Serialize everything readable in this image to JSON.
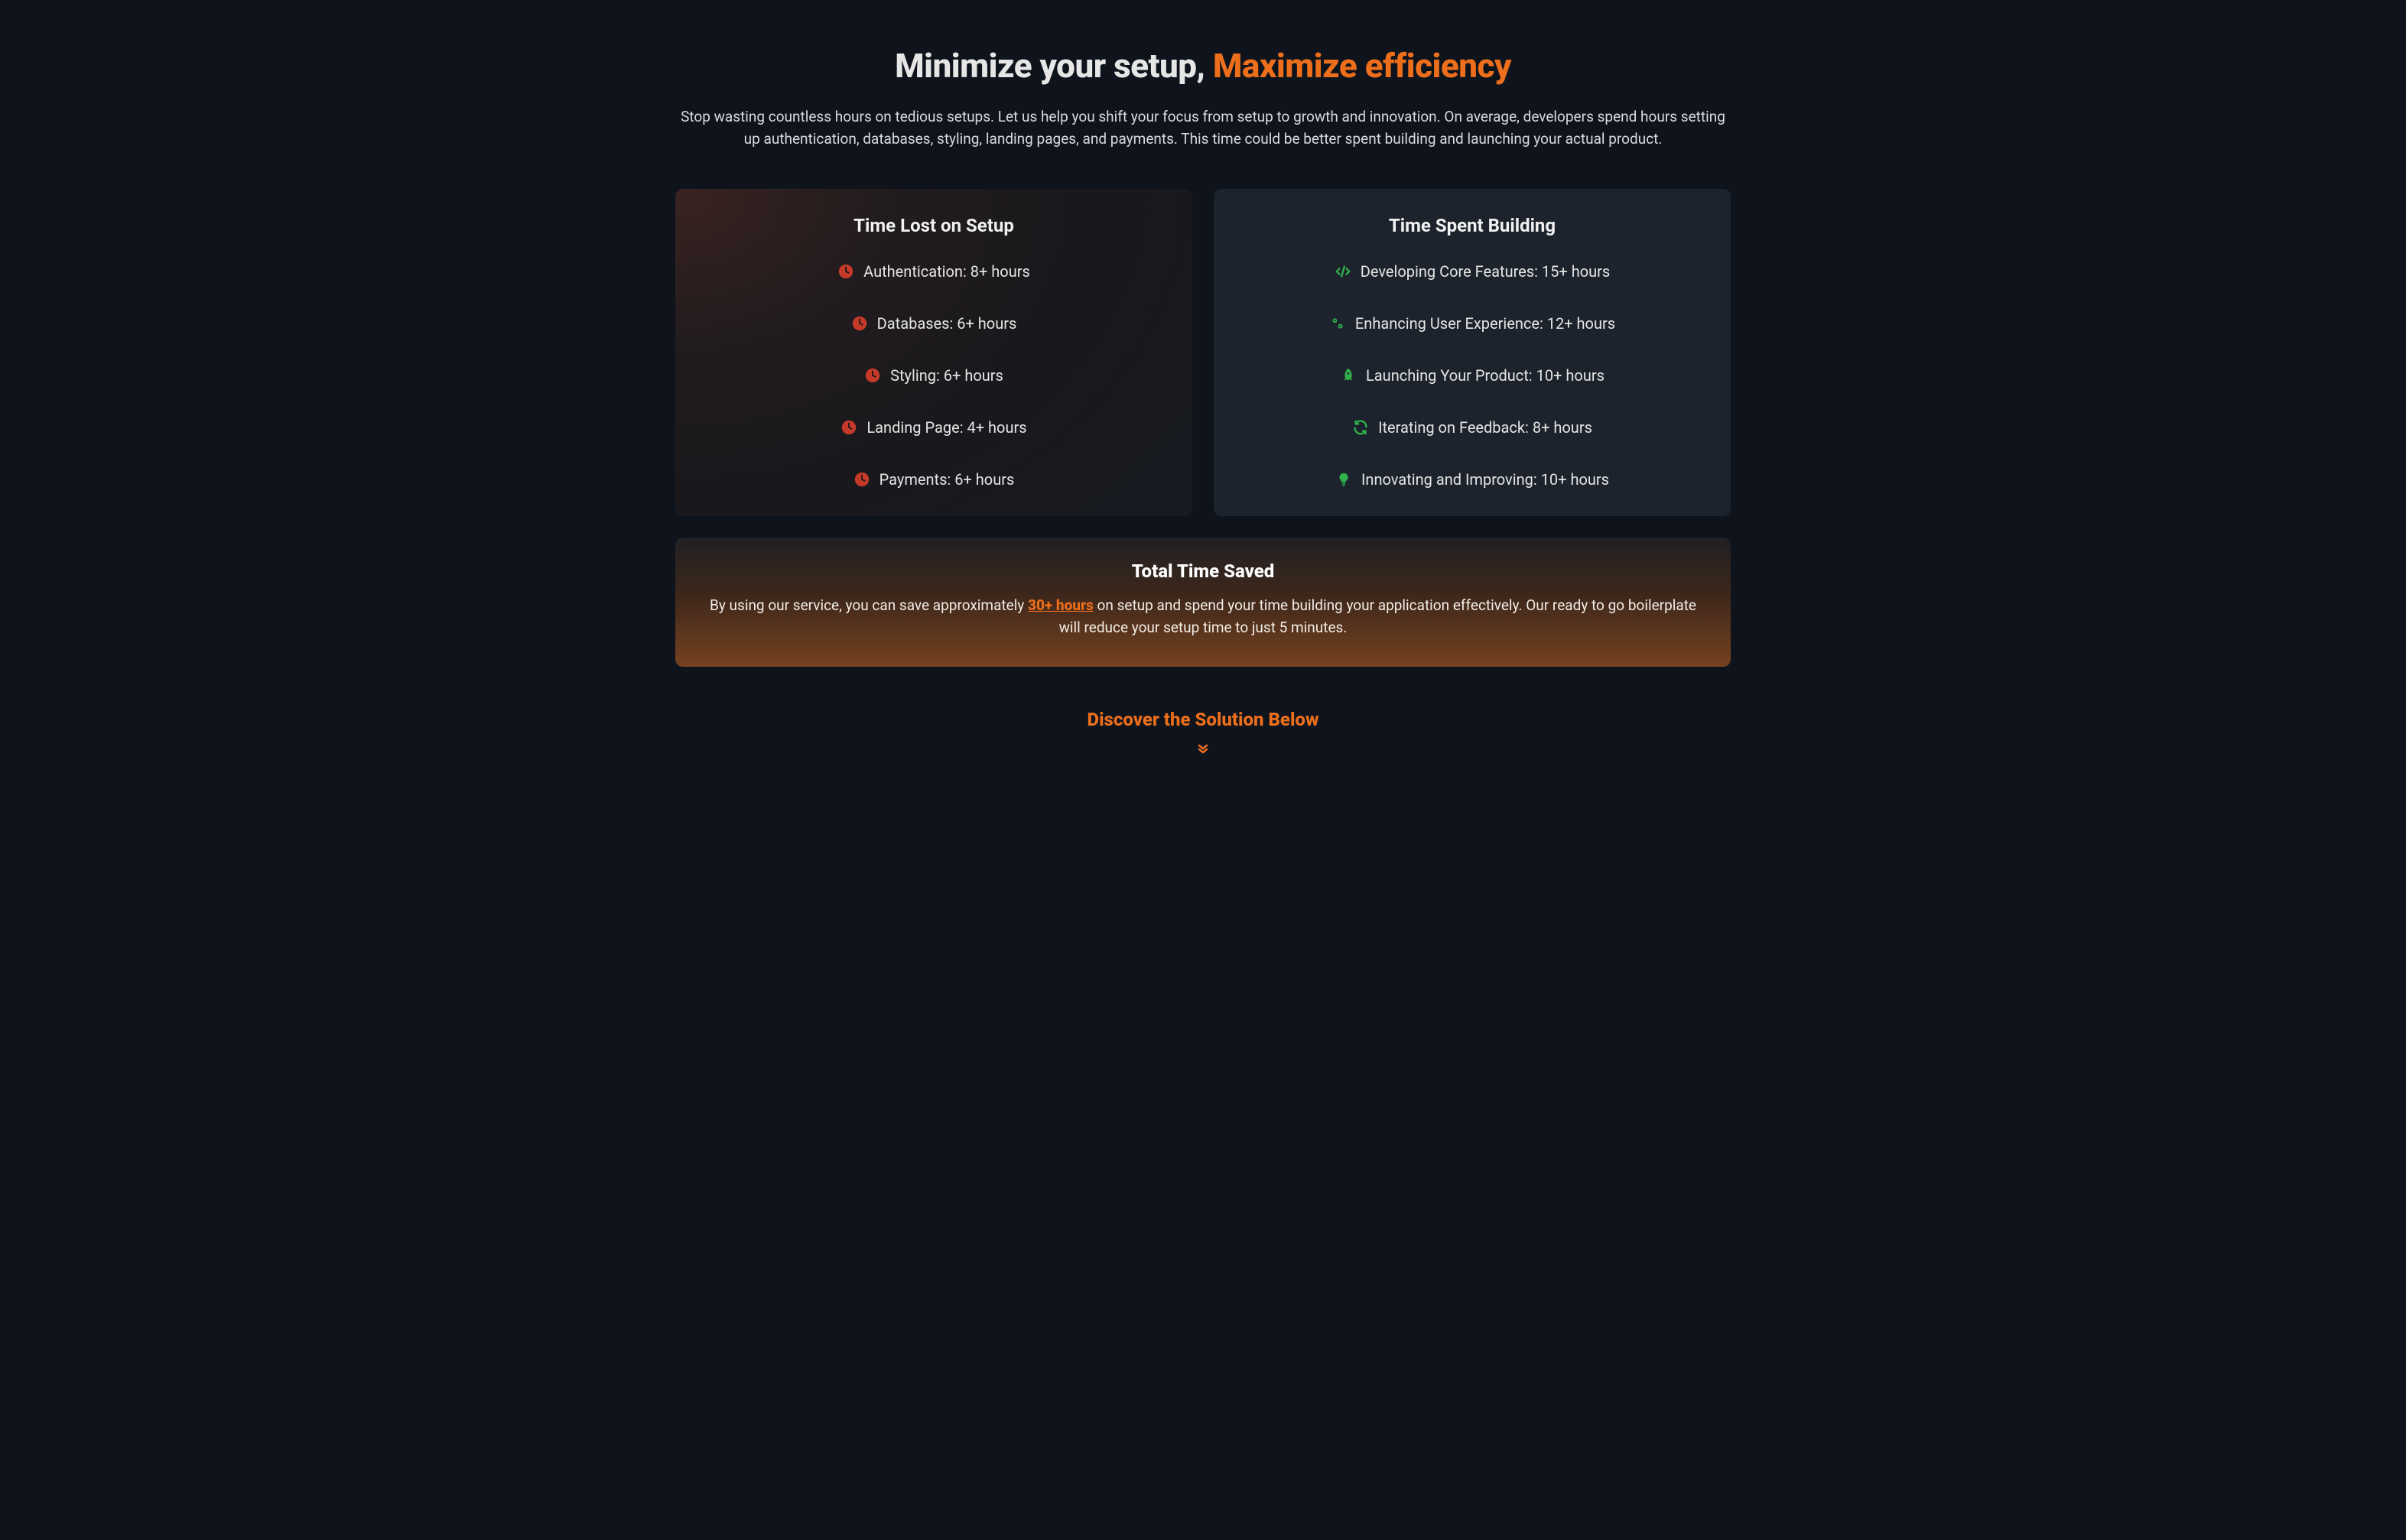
{
  "hero": {
    "title_part1": "Minimize your setup, ",
    "title_part2": "Maximize efficiency",
    "subtitle": "Stop wasting countless hours on tedious setups. Let us help you shift your focus from setup to growth and innovation. On average, developers spend hours setting up authentication, databases, styling, landing pages, and payments. This time could be better spent building and launching your actual product."
  },
  "lost": {
    "heading": "Time Lost on Setup",
    "items": [
      "Authentication: 8+ hours",
      "Databases: 6+ hours",
      "Styling: 6+ hours",
      "Landing Page: 4+ hours",
      "Payments: 6+ hours"
    ]
  },
  "build": {
    "heading": "Time Spent Building",
    "items": [
      "Developing Core Features: 15+ hours",
      "Enhancing User Experience: 12+ hours",
      "Launching Your Product: 10+ hours",
      "Iterating on Feedback: 8+ hours",
      "Innovating and Improving: 10+ hours"
    ]
  },
  "total": {
    "heading": "Total Time Saved",
    "text_before": "By using our service, you can save approximately ",
    "highlight": "30+ hours",
    "text_after": " on setup and spend your time building your application effectively. Our ready to go boilerplate will reduce your setup time to just 5 minutes."
  },
  "discover": {
    "label": "Discover the Solution Below"
  }
}
